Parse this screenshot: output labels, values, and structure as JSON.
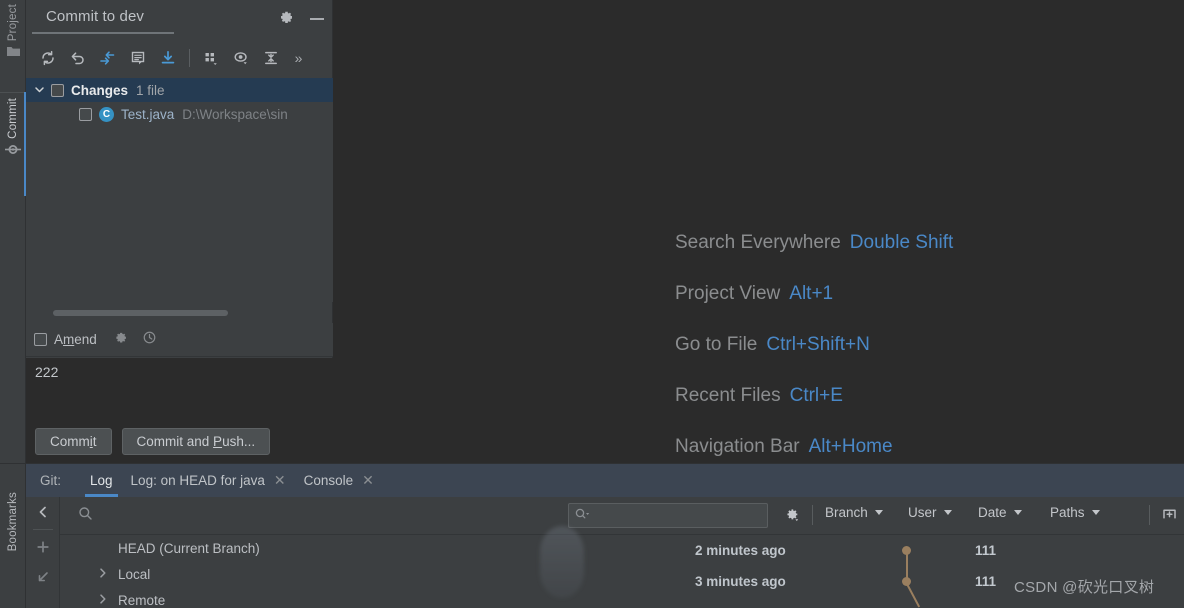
{
  "left_strip": {
    "tabs": [
      {
        "label": "Project",
        "icon": "folder-icon",
        "active": false
      },
      {
        "label": "Commit",
        "icon": "commit-node-icon",
        "active": true
      }
    ],
    "bottom_tabs": [
      {
        "label": "Bookmarks",
        "icon": "bookmark-icon"
      }
    ]
  },
  "commit_panel": {
    "title": "Commit to dev",
    "gear_icon": "gear-icon",
    "minimize_icon": "minimize-icon",
    "toolbar": [
      {
        "name": "refresh-changes-button",
        "icon": "refresh-icon"
      },
      {
        "name": "rollback-button",
        "icon": "rollback-icon"
      },
      {
        "name": "show-diff-button",
        "icon": "diff-arrows-icon"
      },
      {
        "name": "commit-message-history-button",
        "icon": "message-icon"
      },
      {
        "name": "update-project-button",
        "icon": "download-icon"
      },
      {
        "name": "group-by-button",
        "icon": "group-by-icon"
      },
      {
        "name": "preview-diff-button",
        "icon": "eye-icon"
      },
      {
        "name": "expand-collapse-button",
        "icon": "collapse-icon"
      },
      {
        "name": "toolbar-overflow-button",
        "icon": "chevrons-right-icon"
      }
    ],
    "tree": {
      "changes_label": "Changes",
      "changes_count": "1 file",
      "chevron_icon": "chevron-down-icon",
      "file": {
        "icon_letter": "C",
        "name": "Test.java",
        "path": "D:\\Workspace\\sin"
      }
    },
    "amend": {
      "label_pre": "A",
      "label_underlined": "m",
      "label_post": "end",
      "gear_icon": "gear-icon",
      "history_icon": "clock-icon"
    },
    "message": "222",
    "buttons": {
      "commit": {
        "pre": "Comm",
        "underlined": "i",
        "post": "t"
      },
      "commit_and_push": {
        "pre": "Commit and ",
        "underlined": "P",
        "post": "ush..."
      }
    }
  },
  "editor": {
    "hints": [
      {
        "action": "Search Everywhere",
        "shortcut": "Double Shift"
      },
      {
        "action": "Project View",
        "shortcut": "Alt+1"
      },
      {
        "action": "Go to File",
        "shortcut": "Ctrl+Shift+N"
      },
      {
        "action": "Recent Files",
        "shortcut": "Ctrl+E"
      },
      {
        "action": "Navigation Bar",
        "shortcut": "Alt+Home"
      }
    ],
    "shortcut_color": "#4a88c7"
  },
  "bottom_panel": {
    "tool_label": "Git:",
    "tabs": [
      {
        "label": "Log",
        "active": true,
        "closable": false
      },
      {
        "label": "Log: on HEAD for java",
        "active": false,
        "closable": true,
        "close_icon": "close-icon"
      },
      {
        "label": "Console",
        "active": false,
        "closable": true,
        "close_icon": "close-icon"
      }
    ],
    "rail": [
      {
        "name": "collapse-panel-button",
        "icon": "chevron-left-icon"
      },
      {
        "name": "add-button",
        "icon": "plus-icon"
      },
      {
        "name": "collapse-all-button",
        "icon": "arrow-down-left-icon"
      }
    ],
    "branch_search_placeholder": "",
    "branch_search_icon": "search-icon",
    "log_filter": {
      "icon": "search-dropdown-icon",
      "value": ""
    },
    "log_gear_icon": "gear-icon",
    "filters": [
      {
        "label": "Branch",
        "caret": "chevron-down-icon"
      },
      {
        "label": "User",
        "caret": "chevron-down-icon"
      },
      {
        "label": "Date",
        "caret": "chevron-down-icon"
      },
      {
        "label": "Paths",
        "caret": "chevron-down-icon"
      }
    ],
    "right_icons": [
      {
        "name": "open-in-new-tab-button",
        "icon": "new-tab-icon"
      },
      {
        "name": "refresh-log-button",
        "icon": "refresh-icon"
      }
    ],
    "branch_tree": [
      {
        "label": "HEAD (Current Branch)",
        "has_chevron": false
      },
      {
        "label": "Local",
        "has_chevron": true,
        "chevron_icon": "chevron-right-icon"
      },
      {
        "label": "Remote",
        "has_chevron": true,
        "chevron_icon": "chevron-right-icon"
      }
    ],
    "commits": [
      {
        "date": "2 minutes ago",
        "number": "111"
      },
      {
        "date": "3 minutes ago",
        "number": "111"
      }
    ],
    "graph_color": "#9a7f5f"
  },
  "watermark": "CSDN @砍光口叉树",
  "colors": {
    "editor_bg": "#2b2b2b",
    "panel_bg": "#3c3f41",
    "tabbar_bg": "#3c4552",
    "selection_bg": "#253b52",
    "accent": "#4a88c7",
    "java_icon": "#3592c4"
  }
}
